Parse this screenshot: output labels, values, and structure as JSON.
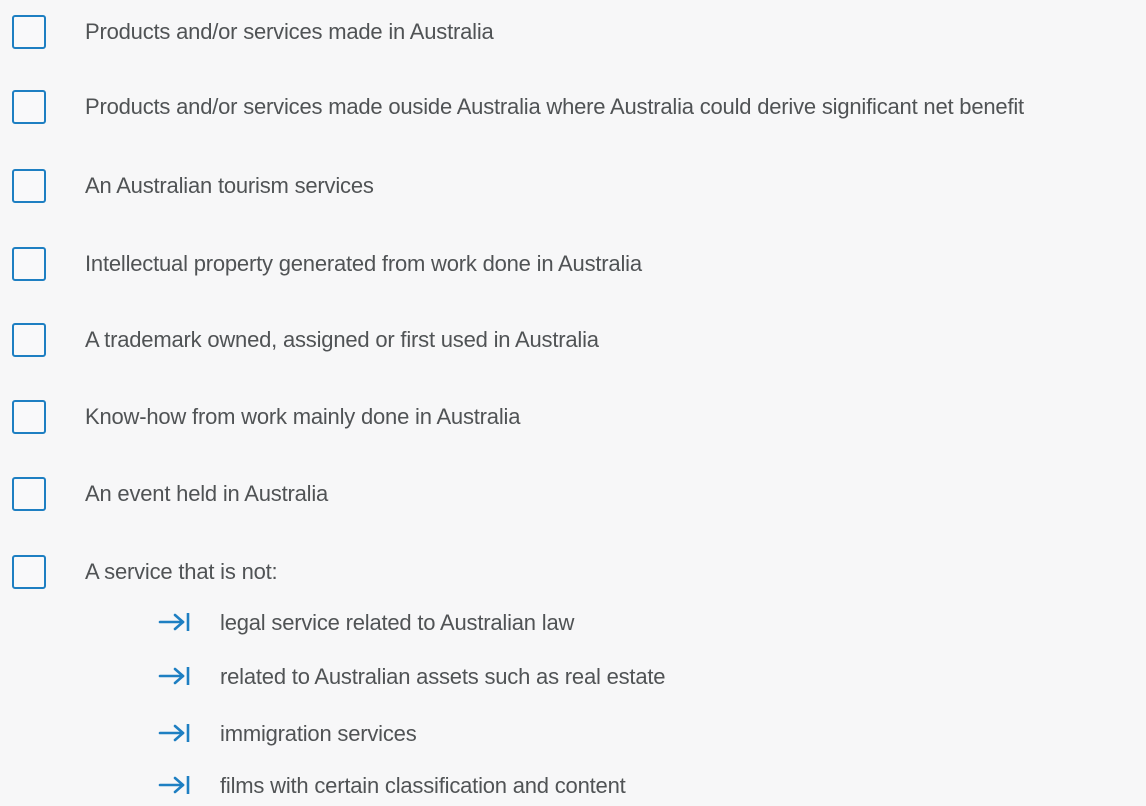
{
  "options": [
    {
      "label": "Products and/or services made in Australia",
      "checked": false
    },
    {
      "label": "Products and/or services made ouside Australia where Australia could derive significant net benefit",
      "checked": false
    },
    {
      "label": "An Australian tourism services",
      "checked": false
    },
    {
      "label": "Intellectual property generated from work done in Australia",
      "checked": false
    },
    {
      "label": "A trademark owned, assigned or first used in Australia",
      "checked": false
    },
    {
      "label": "Know-how from work mainly done in Australia",
      "checked": false
    },
    {
      "label": "An event held in Australia",
      "checked": false
    },
    {
      "label": "A service that is not:",
      "checked": false
    }
  ],
  "exclusions": [
    {
      "label": "legal service related to Australian law",
      "icon": "arrow-to-right-icon"
    },
    {
      "label": "related to Australian assets such as real estate",
      "icon": "arrow-to-right-icon"
    },
    {
      "label": "immigration services",
      "icon": "arrow-to-right-icon"
    },
    {
      "label": "films with certain classification and content",
      "icon": "arrow-to-right-icon"
    }
  ],
  "colors": {
    "accent": "#1e7fc2",
    "text": "#505355",
    "background": "#f7f7f8"
  }
}
